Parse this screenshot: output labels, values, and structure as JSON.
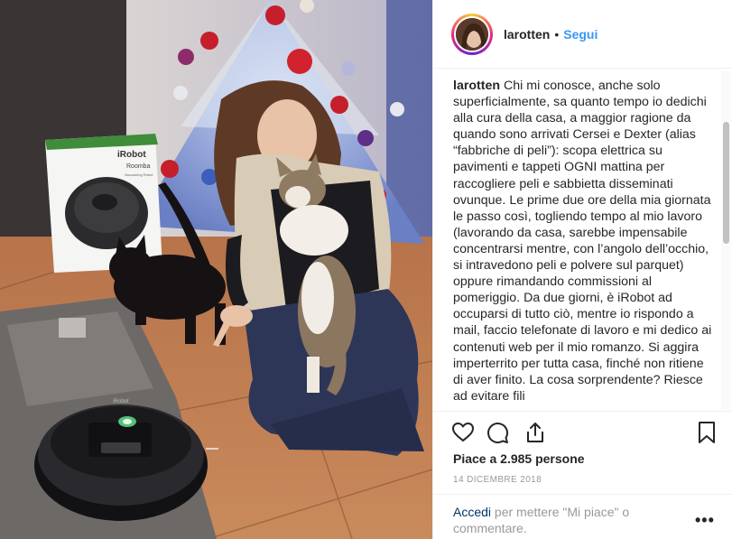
{
  "post": {
    "username": "larotten",
    "separator": "•",
    "follow_label": "Segui",
    "caption_username": "larotten",
    "caption_text": "Chi mi conosce, anche solo superficialmente, sa quanto tempo io dedichi alla cura della casa, a maggior ragione da quando sono arrivati Cersei e Dexter (alias “fabbriche di peli”): scopa elettrica su pavimenti e tappeti OGNI mattina per raccogliere peli e sabbietta disseminati ovunque. Le prime due ore della mia giornata le passo così, togliendo tempo al mio lavoro (lavorando da casa, sarebbe impensabile concentrarsi mentre, con l’angolo dell’occhio, si intravedono peli e polvere sul parquet) oppure rimandando commissioni al pomeriggio. Da due giorni, è iRobot ad occuparsi di tutto ciò, mentre io rispondo a mail, faccio telefonate di lavoro e mi dedico ai contenuti web per il mio romanzo. Si aggira imperterrito per tutta casa, finché non ritiene di aver finito. La cosa sorprendente? Riesce ad evitare fili",
    "likes_text": "Piace a 2.985 persone",
    "date": "14 DICEMBRE 2018",
    "login_link": "Accedi",
    "login_rest": " per mettere \"Mi piace\" o commentare.",
    "more_label": "•••"
  },
  "photo": {
    "box_brand": "iRobot",
    "box_model": "Roomba",
    "box_subtitle": "Vacuuming Robot",
    "robot_brand": "iRobot"
  },
  "icons": {
    "like": "heart-icon",
    "comment": "comment-icon",
    "share": "share-icon",
    "save": "bookmark-icon",
    "more": "more-options-icon"
  },
  "colors": {
    "follow": "#3897f0",
    "link": "#003569",
    "muted": "#999999",
    "text": "#262626",
    "border": "#efefef"
  }
}
